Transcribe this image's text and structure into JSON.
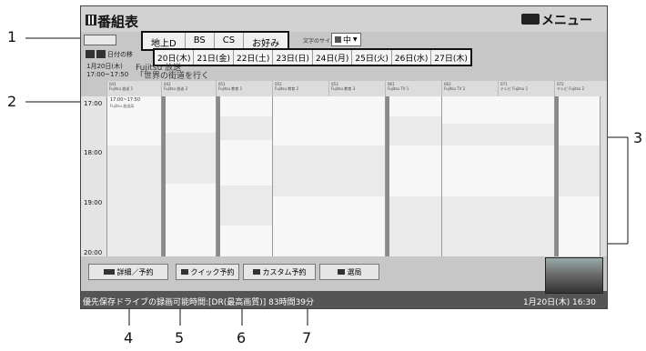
{
  "app": {
    "title": "番組表",
    "menu_label": "メニュー"
  },
  "tabs": [
    "地上D",
    "BS",
    "CS",
    "お好み"
  ],
  "font_size": {
    "label": "文字のサイズ：",
    "value": "中"
  },
  "nav": {
    "label": "日付の移"
  },
  "dates": [
    "20日(木)",
    "21日(金)",
    "22日(土)",
    "23日(日)",
    "24日(月)",
    "25日(火)",
    "26日(水)",
    "27日(木)"
  ],
  "current": {
    "date": "1月20日(木)",
    "time": "17:00~17:50",
    "station": "Fujitsu 放送",
    "program": "「世界の街道を行く"
  },
  "channels": [
    {
      "num": "041",
      "name": "Fujitsu 放送 1"
    },
    {
      "num": "042",
      "name": "Fujitsu 放送 2"
    },
    {
      "num": "051",
      "name": "Fujitsu 教育 1"
    },
    {
      "num": "052",
      "name": "Fujitsu 教育 2"
    },
    {
      "num": "053",
      "name": "Fujitsu 教育 3"
    },
    {
      "num": "061",
      "name": "Fujitsu TV 1"
    },
    {
      "num": "062",
      "name": "Fujitsu TV 2"
    },
    {
      "num": "071",
      "name": "テレビ Fujitsu 1"
    },
    {
      "num": "072",
      "name": "テレビ Fujitsu 2"
    }
  ],
  "times": [
    "17:00",
    "18:00",
    "19:00",
    "20:00"
  ],
  "first_cell": {
    "time": "17:00~17:50",
    "station": "Fujitsu 放送局"
  },
  "buttons": {
    "detail": "詳細／予約",
    "quick": "クイック予約",
    "custom": "カスタム予約",
    "channel": "選局"
  },
  "status": {
    "left": "優先保存ドライブの録画可能時間:[DR(最高画質)] 83時間39分",
    "right": "1月20日(木) 16:30"
  },
  "callouts": [
    "1",
    "2",
    "3",
    "4",
    "5",
    "6",
    "7"
  ]
}
